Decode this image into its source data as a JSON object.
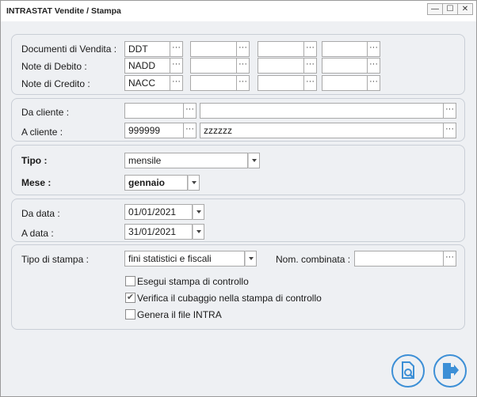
{
  "window": {
    "title": "INTRASTAT Vendite / Stampa",
    "minimize": "—",
    "maximize": "☐",
    "close": "✕"
  },
  "documents": {
    "rows": [
      {
        "label": "Documenti di Vendita :",
        "values": [
          "DDT",
          "",
          "",
          ""
        ]
      },
      {
        "label": "Note di Debito :",
        "values": [
          "NADD",
          "",
          "",
          ""
        ]
      },
      {
        "label": "Note di Credito :",
        "values": [
          "NACC",
          "",
          "",
          ""
        ]
      }
    ],
    "dots": "···"
  },
  "clients": {
    "from_label": "Da cliente :",
    "from_code": "",
    "from_name": "",
    "to_label": "A cliente :",
    "to_code": "999999",
    "to_name": "zzzzzz"
  },
  "period": {
    "tipo_label": "Tipo :",
    "tipo_value": "mensile",
    "mese_label": "Mese :",
    "mese_value": "gennaio"
  },
  "dates": {
    "from_label": "Da data :",
    "from_value": "01/01/2021",
    "to_label": "A data :",
    "to_value": "31/01/2021"
  },
  "print": {
    "tipo_label": "Tipo di stampa :",
    "tipo_value": "fini statistici e fiscali",
    "nom_label": "Nom. combinata :",
    "nom_value": "",
    "options": [
      {
        "label": "Esegui stampa di controllo",
        "checked": false
      },
      {
        "label": "Verifica il cubaggio nella stampa di controllo",
        "checked": true
      },
      {
        "label": "Genera il file INTRA",
        "checked": false
      }
    ],
    "check_mark": "✔"
  },
  "accent_color": "#3c8fd6"
}
